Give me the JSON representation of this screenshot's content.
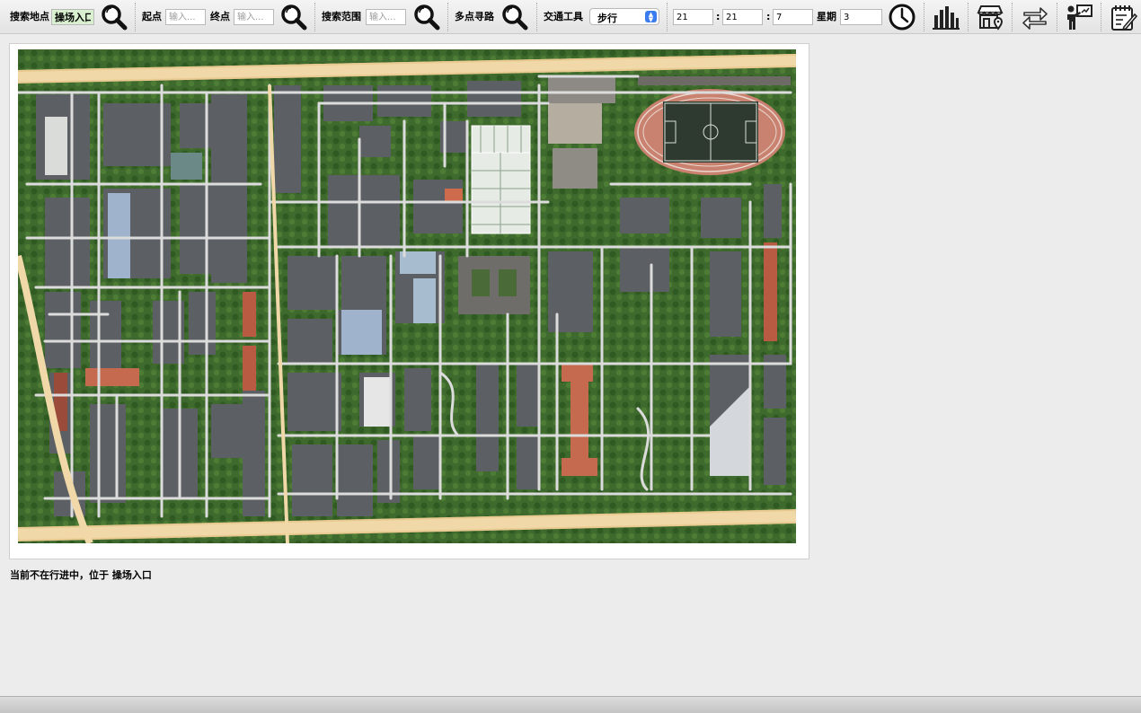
{
  "toolbar": {
    "search_place": {
      "label": "搜索地点",
      "value": "操场入口"
    },
    "route": {
      "start_label": "起点",
      "start_placeholder": "输入...",
      "end_label": "终点",
      "end_placeholder": "输入..."
    },
    "range": {
      "label": "搜索范围",
      "placeholder": "输入..."
    },
    "multi": {
      "label": "多点寻路"
    },
    "transport": {
      "label": "交通工具",
      "selected": "步行"
    },
    "time": {
      "hour": "21",
      "minute": "21",
      "second": "7",
      "sep1": ":",
      "sep2": ":"
    },
    "weekday": {
      "label": "星期",
      "value": "3"
    },
    "icons": {
      "search": "magnifier-icon",
      "clock": "clock-icon",
      "stats": "bar-chart-icon",
      "store": "store-location-icon",
      "swap": "swap-arrows-icon",
      "teacher": "teacher-board-icon",
      "notes": "notepad-icon"
    }
  },
  "map": {
    "description_icon": "campus-satellite-map"
  },
  "status": {
    "text": "当前不在行进中，位于 操场入口"
  }
}
